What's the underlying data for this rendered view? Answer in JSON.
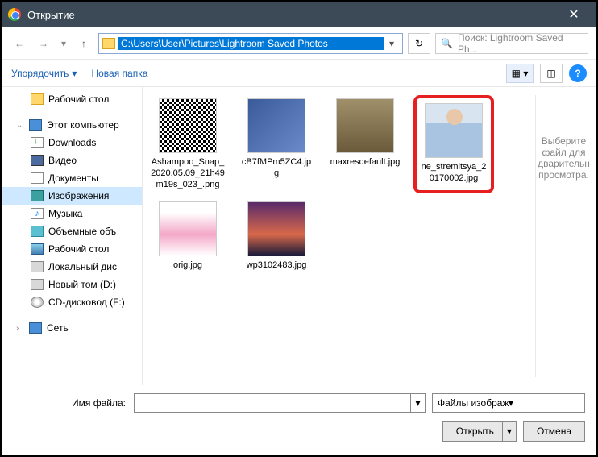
{
  "titlebar": {
    "title": "Открытие"
  },
  "nav": {
    "path": "C:\\Users\\User\\Pictures\\Lightroom Saved Photos",
    "search_placeholder": "Поиск: Lightroom Saved Ph..."
  },
  "toolbar": {
    "organize": "Упорядочить",
    "newfolder": "Новая папка"
  },
  "sidebar": {
    "desktop": "Рабочий стол",
    "thispc": "Этот компьютер",
    "downloads": "Downloads",
    "video": "Видео",
    "documents": "Документы",
    "images": "Изображения",
    "music": "Музыка",
    "objects3d": "Объемные объ",
    "desktop2": "Рабочий стол",
    "localdisk": "Локальный дис",
    "newvol": "Новый том (D:)",
    "cddvd": "CD-дисковод (F:)",
    "network": "Сеть"
  },
  "files": [
    {
      "name": "Ashampoo_Snap_2020.05.09_21h49m19s_023_.png",
      "thumb": "qr"
    },
    {
      "name": "cB7fMPm5ZC4.jpg",
      "thumb": "blue"
    },
    {
      "name": "maxresdefault.jpg",
      "thumb": "sepia"
    },
    {
      "name": "ne_stremitsya_20170002.jpg",
      "thumb": "man",
      "highlight": true
    },
    {
      "name": "orig.jpg",
      "thumb": "pink"
    },
    {
      "name": "wp3102483.jpg",
      "thumb": "city"
    }
  ],
  "preview": {
    "text": "Выберите файл для дварительн просмотра."
  },
  "bottom": {
    "filename_label": "Имя файла:",
    "filename_value": "",
    "filter": "Файлы изображений (*.tiff;*.p",
    "open": "Открыть",
    "cancel": "Отмена"
  }
}
